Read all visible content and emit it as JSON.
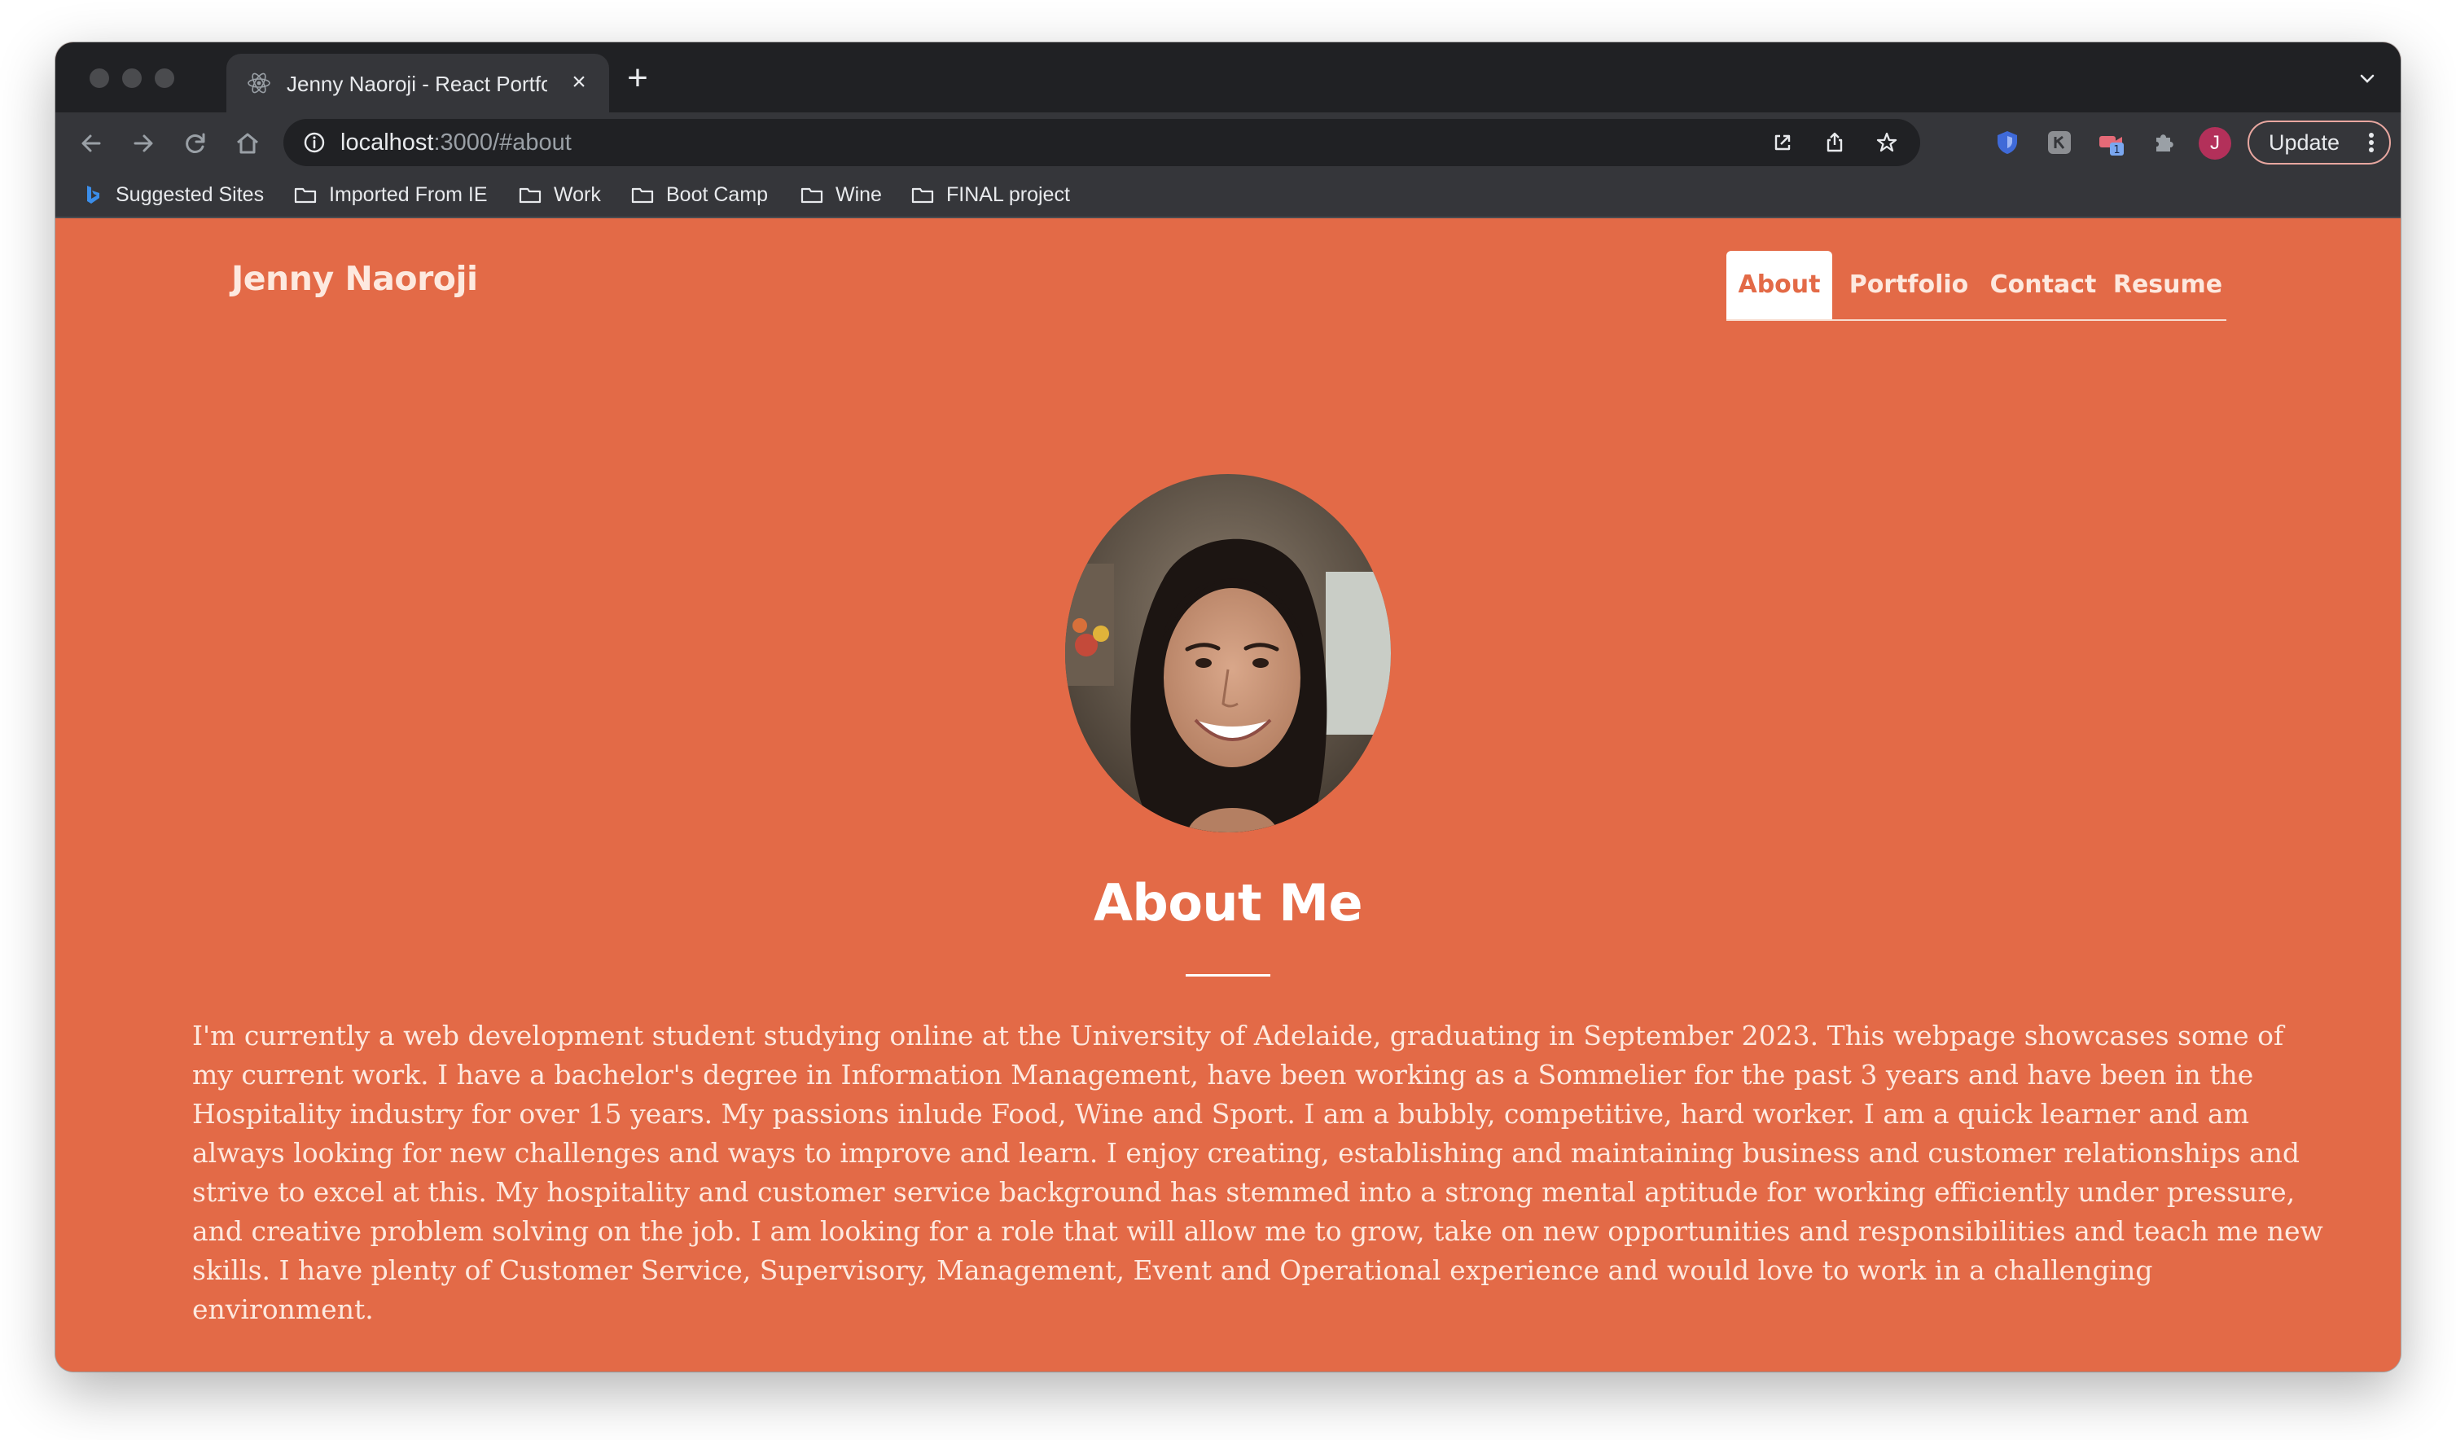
{
  "browser": {
    "tab_title": "Jenny Naoroji - React Portfolio",
    "tab_close": "×",
    "new_tab": "+",
    "url_host": "localhost",
    "url_rest": ":3000/#about",
    "profile_initial": "J",
    "update_label": "Update",
    "extension_badge": "1",
    "bookmarks": [
      {
        "label": "Suggested Sites",
        "icon": "bing-icon"
      },
      {
        "label": "Imported From IE",
        "icon": "folder-icon"
      },
      {
        "label": "Work",
        "icon": "folder-icon"
      },
      {
        "label": "Boot Camp",
        "icon": "folder-icon"
      },
      {
        "label": "Wine",
        "icon": "folder-icon"
      },
      {
        "label": "FINAL project",
        "icon": "folder-icon"
      }
    ]
  },
  "site": {
    "brand": "Jenny Naoroji",
    "nav": [
      {
        "label": "About",
        "active": true
      },
      {
        "label": "Portfolio",
        "active": false
      },
      {
        "label": "Contact",
        "active": false
      },
      {
        "label": "Resume",
        "active": false
      }
    ]
  },
  "about": {
    "title": "About Me",
    "body": "I'm currently a web development student studying online at the University of Adelaide, graduating in September 2023. This webpage showcases some of my current work. I have a bachelor's degree in Information Management, have been working as a Sommelier for the past 3 years and have been in the Hospitality industry for over 15 years. My passions inlude Food, Wine and Sport. I am a bubbly, competitive, hard worker. I am a quick learner and am always looking for new challenges and ways to improve and learn. I enjoy creating, establishing and maintaining business and customer relationships and strive to excel at this. My hospitality and customer service background has stemmed into a strong mental aptitude for working efficiently under pressure, and creative problem solving on the job. I am looking for a role that will allow me to grow, take on new opportunities and responsibilities and teach me new skills. I have plenty of Customer Service, Supervisory, Management, Event and Operational experience and would love to work in a challenging environment."
  },
  "colors": {
    "page_background": "#e36a47",
    "active_nav_text": "#e36a47",
    "chrome_dark": "#202124",
    "chrome_toolbar": "#35363a"
  }
}
